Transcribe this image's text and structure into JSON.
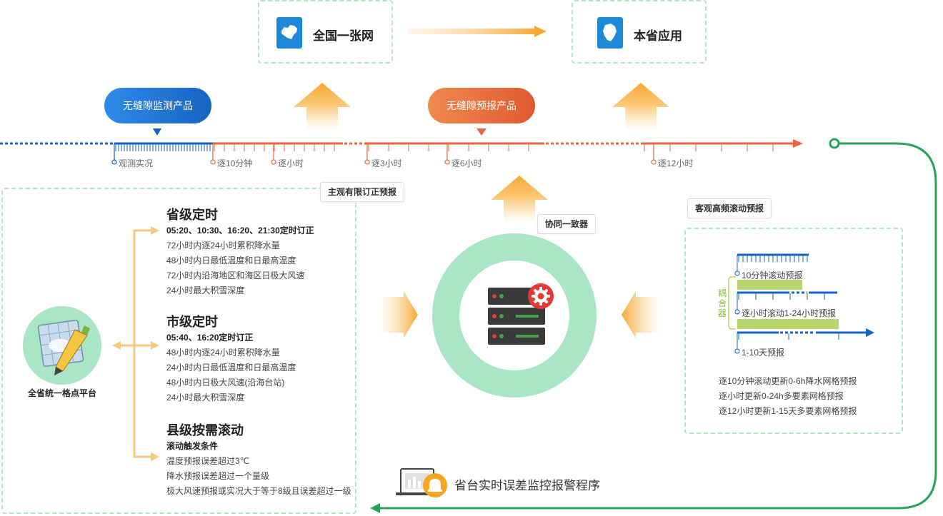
{
  "top": {
    "left_card": {
      "label": "全国一张网",
      "icon": "china-map-icon"
    },
    "right_card": {
      "label": "本省应用",
      "icon": "province-map-icon"
    }
  },
  "pills": {
    "monitor": "无缝隙监测产品",
    "forecast": "无缝隙预报产品"
  },
  "timeline": {
    "labels": [
      "观测实况",
      "逐10分钟",
      "逐小时",
      "逐3小时",
      "逐6小时",
      "逐12小时"
    ]
  },
  "callouts": {
    "subjective": "主观有限订正预报",
    "coordinator": "协同一致器",
    "objective": "客观高频滚动预报"
  },
  "platform": {
    "label": "全省统一格点平台"
  },
  "sections": [
    {
      "title": "省级定时",
      "subtitle": "05:20、10:30、16:20、21:30定时订正",
      "lines": [
        "72小时内逐24小时累积降水量",
        "48小时内日最低温度和日最高温度",
        "72小时内沿海地区和海区日极大风速",
        "24小时最大积雪深度"
      ]
    },
    {
      "title": "市级定时",
      "subtitle": "05:40、16:20定时订正",
      "lines": [
        "48小时内逐24小时累积降水量",
        "24小时内日最低温度和日最高温度",
        "48小时内日极大风速(沿海台站)",
        "24小时最大积雪深度"
      ]
    },
    {
      "title": "县级按需滚动",
      "subtitle": "滚动触发条件",
      "lines": [
        "温度预报误差超过3℃",
        "降水预报误差超过一个量级",
        "极大风速预报或实况大于等于8级且误差超过一级"
      ]
    }
  ],
  "objective_panel": {
    "coupler": "耦合器",
    "labels": [
      "10分钟滚动预报",
      "逐小时滚动1-24小时预报",
      "1-10天预报"
    ],
    "lines": [
      "逐10分钟滚动更新0-6h降水网格预报",
      "逐小时更新0-24h多要素网格预报",
      "逐12小时更新1-15天多要素网格预报"
    ]
  },
  "alarm": {
    "label": "省台实时误差监控报警程序"
  },
  "colors": {
    "blue": "#1565c0",
    "orange": "#e8663d",
    "green": "#27a35a",
    "light_green": "#a8e6c4",
    "arrow_orange": "#f7b24a",
    "bar_green": "#b5d66b"
  }
}
